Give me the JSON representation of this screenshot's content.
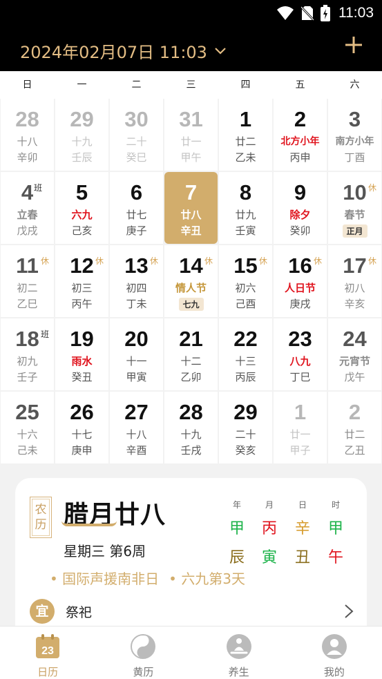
{
  "status": {
    "time": "11:03"
  },
  "header": {
    "date_title": "2024年02月07日 11:03"
  },
  "weekdays": [
    "日",
    "一",
    "二",
    "三",
    "四",
    "五",
    "六"
  ],
  "days": [
    {
      "num": "28",
      "l1": "十八",
      "l2": "辛卯",
      "dim": true
    },
    {
      "num": "29",
      "l1": "十九",
      "l2": "壬辰",
      "dim": true
    },
    {
      "num": "30",
      "l1": "二十",
      "l2": "癸巳",
      "dim": true
    },
    {
      "num": "31",
      "l1": "廿一",
      "l2": "甲午",
      "dim": true
    },
    {
      "num": "1",
      "l1": "廿二",
      "l2": "乙未"
    },
    {
      "num": "2",
      "l1": "北方小年",
      "l2": "丙申",
      "l1style": "red"
    },
    {
      "num": "3",
      "l1": "南方小年",
      "l2": "丁酉",
      "l1style": "red"
    },
    {
      "num": "4",
      "l1": "立春",
      "l2": "戊戌",
      "l1style": "red",
      "badge": "班"
    },
    {
      "num": "5",
      "l1": "六九",
      "l2": "己亥",
      "l1style": "red"
    },
    {
      "num": "6",
      "l1": "廿七",
      "l2": "庚子"
    },
    {
      "num": "7",
      "l1": "廿八",
      "l2": "辛丑",
      "selected": true
    },
    {
      "num": "8",
      "l1": "廿九",
      "l2": "壬寅"
    },
    {
      "num": "9",
      "l1": "除夕",
      "l2": "癸卯",
      "l1style": "red"
    },
    {
      "num": "10",
      "l1": "春节",
      "tag": "正月",
      "l1style": "red",
      "badge": "休"
    },
    {
      "num": "11",
      "l1": "初二",
      "l2": "乙巳",
      "badge": "休"
    },
    {
      "num": "12",
      "l1": "初三",
      "l2": "丙午",
      "badge": "休"
    },
    {
      "num": "13",
      "l1": "初四",
      "l2": "丁未",
      "badge": "休"
    },
    {
      "num": "14",
      "l1": "情人节",
      "tag": "七九",
      "l1style": "gold",
      "badge": "休"
    },
    {
      "num": "15",
      "l1": "初六",
      "l2": "己酉",
      "badge": "休"
    },
    {
      "num": "16",
      "l1": "人日节",
      "l2": "庚戌",
      "l1style": "red",
      "badge": "休"
    },
    {
      "num": "17",
      "l1": "初八",
      "l2": "辛亥",
      "badge": "休"
    },
    {
      "num": "18",
      "l1": "初九",
      "l2": "壬子",
      "badge": "班"
    },
    {
      "num": "19",
      "l1": "雨水",
      "l2": "癸丑",
      "l1style": "red"
    },
    {
      "num": "20",
      "l1": "十一",
      "l2": "甲寅"
    },
    {
      "num": "21",
      "l1": "十二",
      "l2": "乙卯"
    },
    {
      "num": "22",
      "l1": "十三",
      "l2": "丙辰"
    },
    {
      "num": "23",
      "l1": "八九",
      "l2": "丁巳",
      "l1style": "red"
    },
    {
      "num": "24",
      "l1": "元宵节",
      "l2": "戊午",
      "l1style": "red"
    },
    {
      "num": "25",
      "l1": "十六",
      "l2": "己未"
    },
    {
      "num": "26",
      "l1": "十七",
      "l2": "庚申"
    },
    {
      "num": "27",
      "l1": "十八",
      "l2": "辛酉"
    },
    {
      "num": "28",
      "l1": "十九",
      "l2": "壬戌"
    },
    {
      "num": "29",
      "l1": "二十",
      "l2": "癸亥"
    },
    {
      "num": "1",
      "l1": "廿一",
      "l2": "甲子",
      "dim": true
    },
    {
      "num": "2",
      "l1": "廿二",
      "l2": "乙丑",
      "dim": true
    }
  ],
  "card": {
    "seal_top": "农",
    "seal_bottom": "历",
    "lunar_date": "腊月廿八",
    "week_info": "星期三 第6周",
    "ganzhi": [
      {
        "head": "年",
        "stem": "甲",
        "branch": "辰",
        "stem_color": "#1db34a",
        "branch_color": "#8a6d1c"
      },
      {
        "head": "月",
        "stem": "丙",
        "branch": "寅",
        "stem_color": "#e0141e",
        "branch_color": "#1db34a"
      },
      {
        "head": "日",
        "stem": "辛",
        "branch": "丑",
        "stem_color": "#d69a2a",
        "branch_color": "#8a6d1c"
      },
      {
        "head": "时",
        "stem": "甲",
        "branch": "午",
        "stem_color": "#1db34a",
        "branch_color": "#e0141e"
      }
    ],
    "events": [
      "国际声援南非日",
      "六九第3天"
    ],
    "yi_label": "宜",
    "yi_text": "祭祀"
  },
  "tabs": [
    {
      "label": "日历",
      "icon": "calendar-icon",
      "active": true,
      "day": "23"
    },
    {
      "label": "黄历",
      "icon": "yin-yang-icon"
    },
    {
      "label": "养生",
      "icon": "meditation-icon"
    },
    {
      "label": "我的",
      "icon": "profile-icon"
    }
  ],
  "colors": {
    "accent": "#d2ad6c",
    "header_text": "#e3bd84",
    "festival_red": "#e0141e"
  }
}
